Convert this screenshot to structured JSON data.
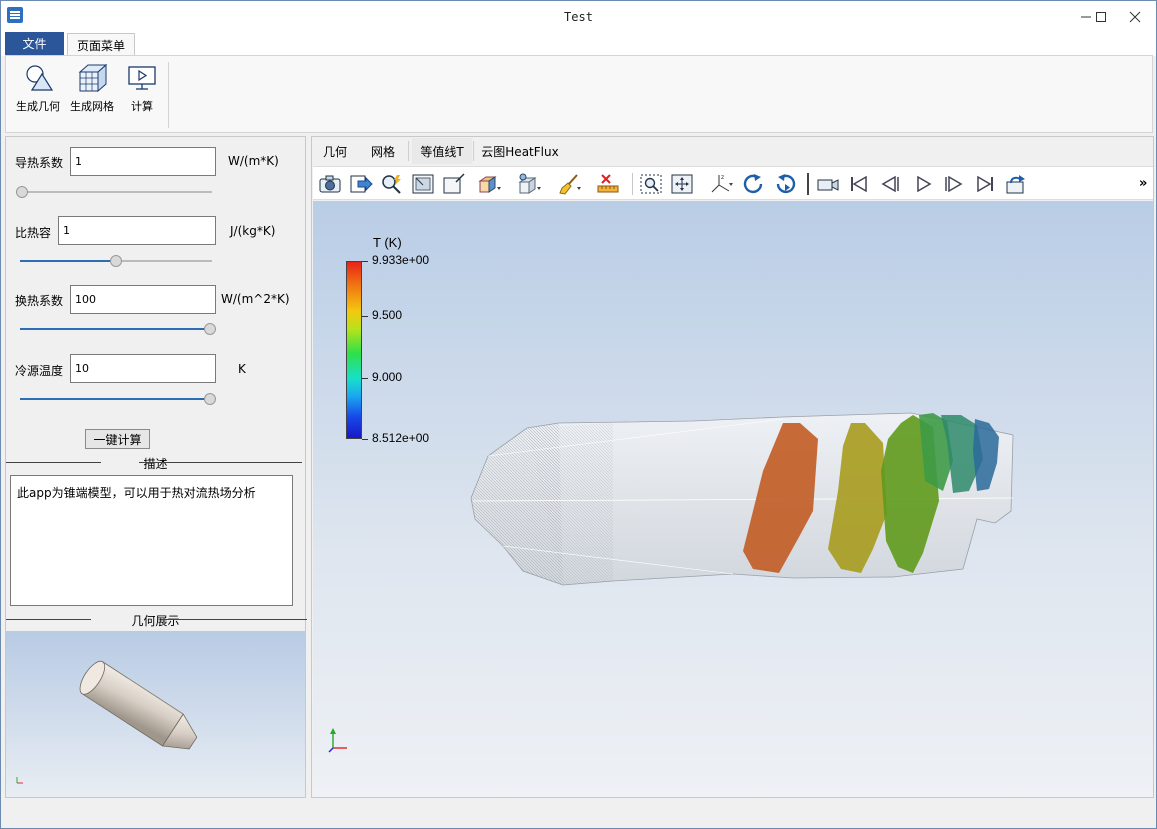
{
  "window": {
    "title": "Test"
  },
  "ribbon": {
    "tabs": [
      {
        "label": "文件"
      },
      {
        "label": "页面菜单"
      }
    ],
    "buttons": [
      {
        "label": "生成几何",
        "icon": "geometry-icon"
      },
      {
        "label": "生成网格",
        "icon": "mesh-icon"
      },
      {
        "label": "计算",
        "icon": "compute-icon"
      }
    ]
  },
  "params": [
    {
      "label": "导热系数",
      "value": "1",
      "unit": "W/(m*K)",
      "slider_fraction": 0.0
    },
    {
      "label": "比热容",
      "value": "1",
      "unit": "J/(kg*K)",
      "slider_fraction": 0.5
    },
    {
      "label": "换热系数",
      "value": "100",
      "unit": "W/(m^2*K)",
      "slider_fraction": 1.0
    },
    {
      "label": "冷源温度",
      "value": "10",
      "unit": "K",
      "slider_fraction": 1.0
    }
  ],
  "calc_button": "一键计算",
  "description": {
    "title": "描述",
    "text": "此app为锥端模型，可以用于热对流热场分析"
  },
  "geometry": {
    "title": "几何展示"
  },
  "view_tabs": [
    {
      "label": "几何"
    },
    {
      "label": "网格"
    },
    {
      "label": "等值线T"
    },
    {
      "label": "云图HeatFlux"
    }
  ],
  "toolbar": {
    "more": "»"
  },
  "legend": {
    "title": "T (K)",
    "labels": [
      "9.933e+00",
      "9.500",
      "9.000",
      "8.512e+00"
    ]
  },
  "colors": {
    "accent": "#2b579a",
    "slider": "#2c6db3"
  }
}
